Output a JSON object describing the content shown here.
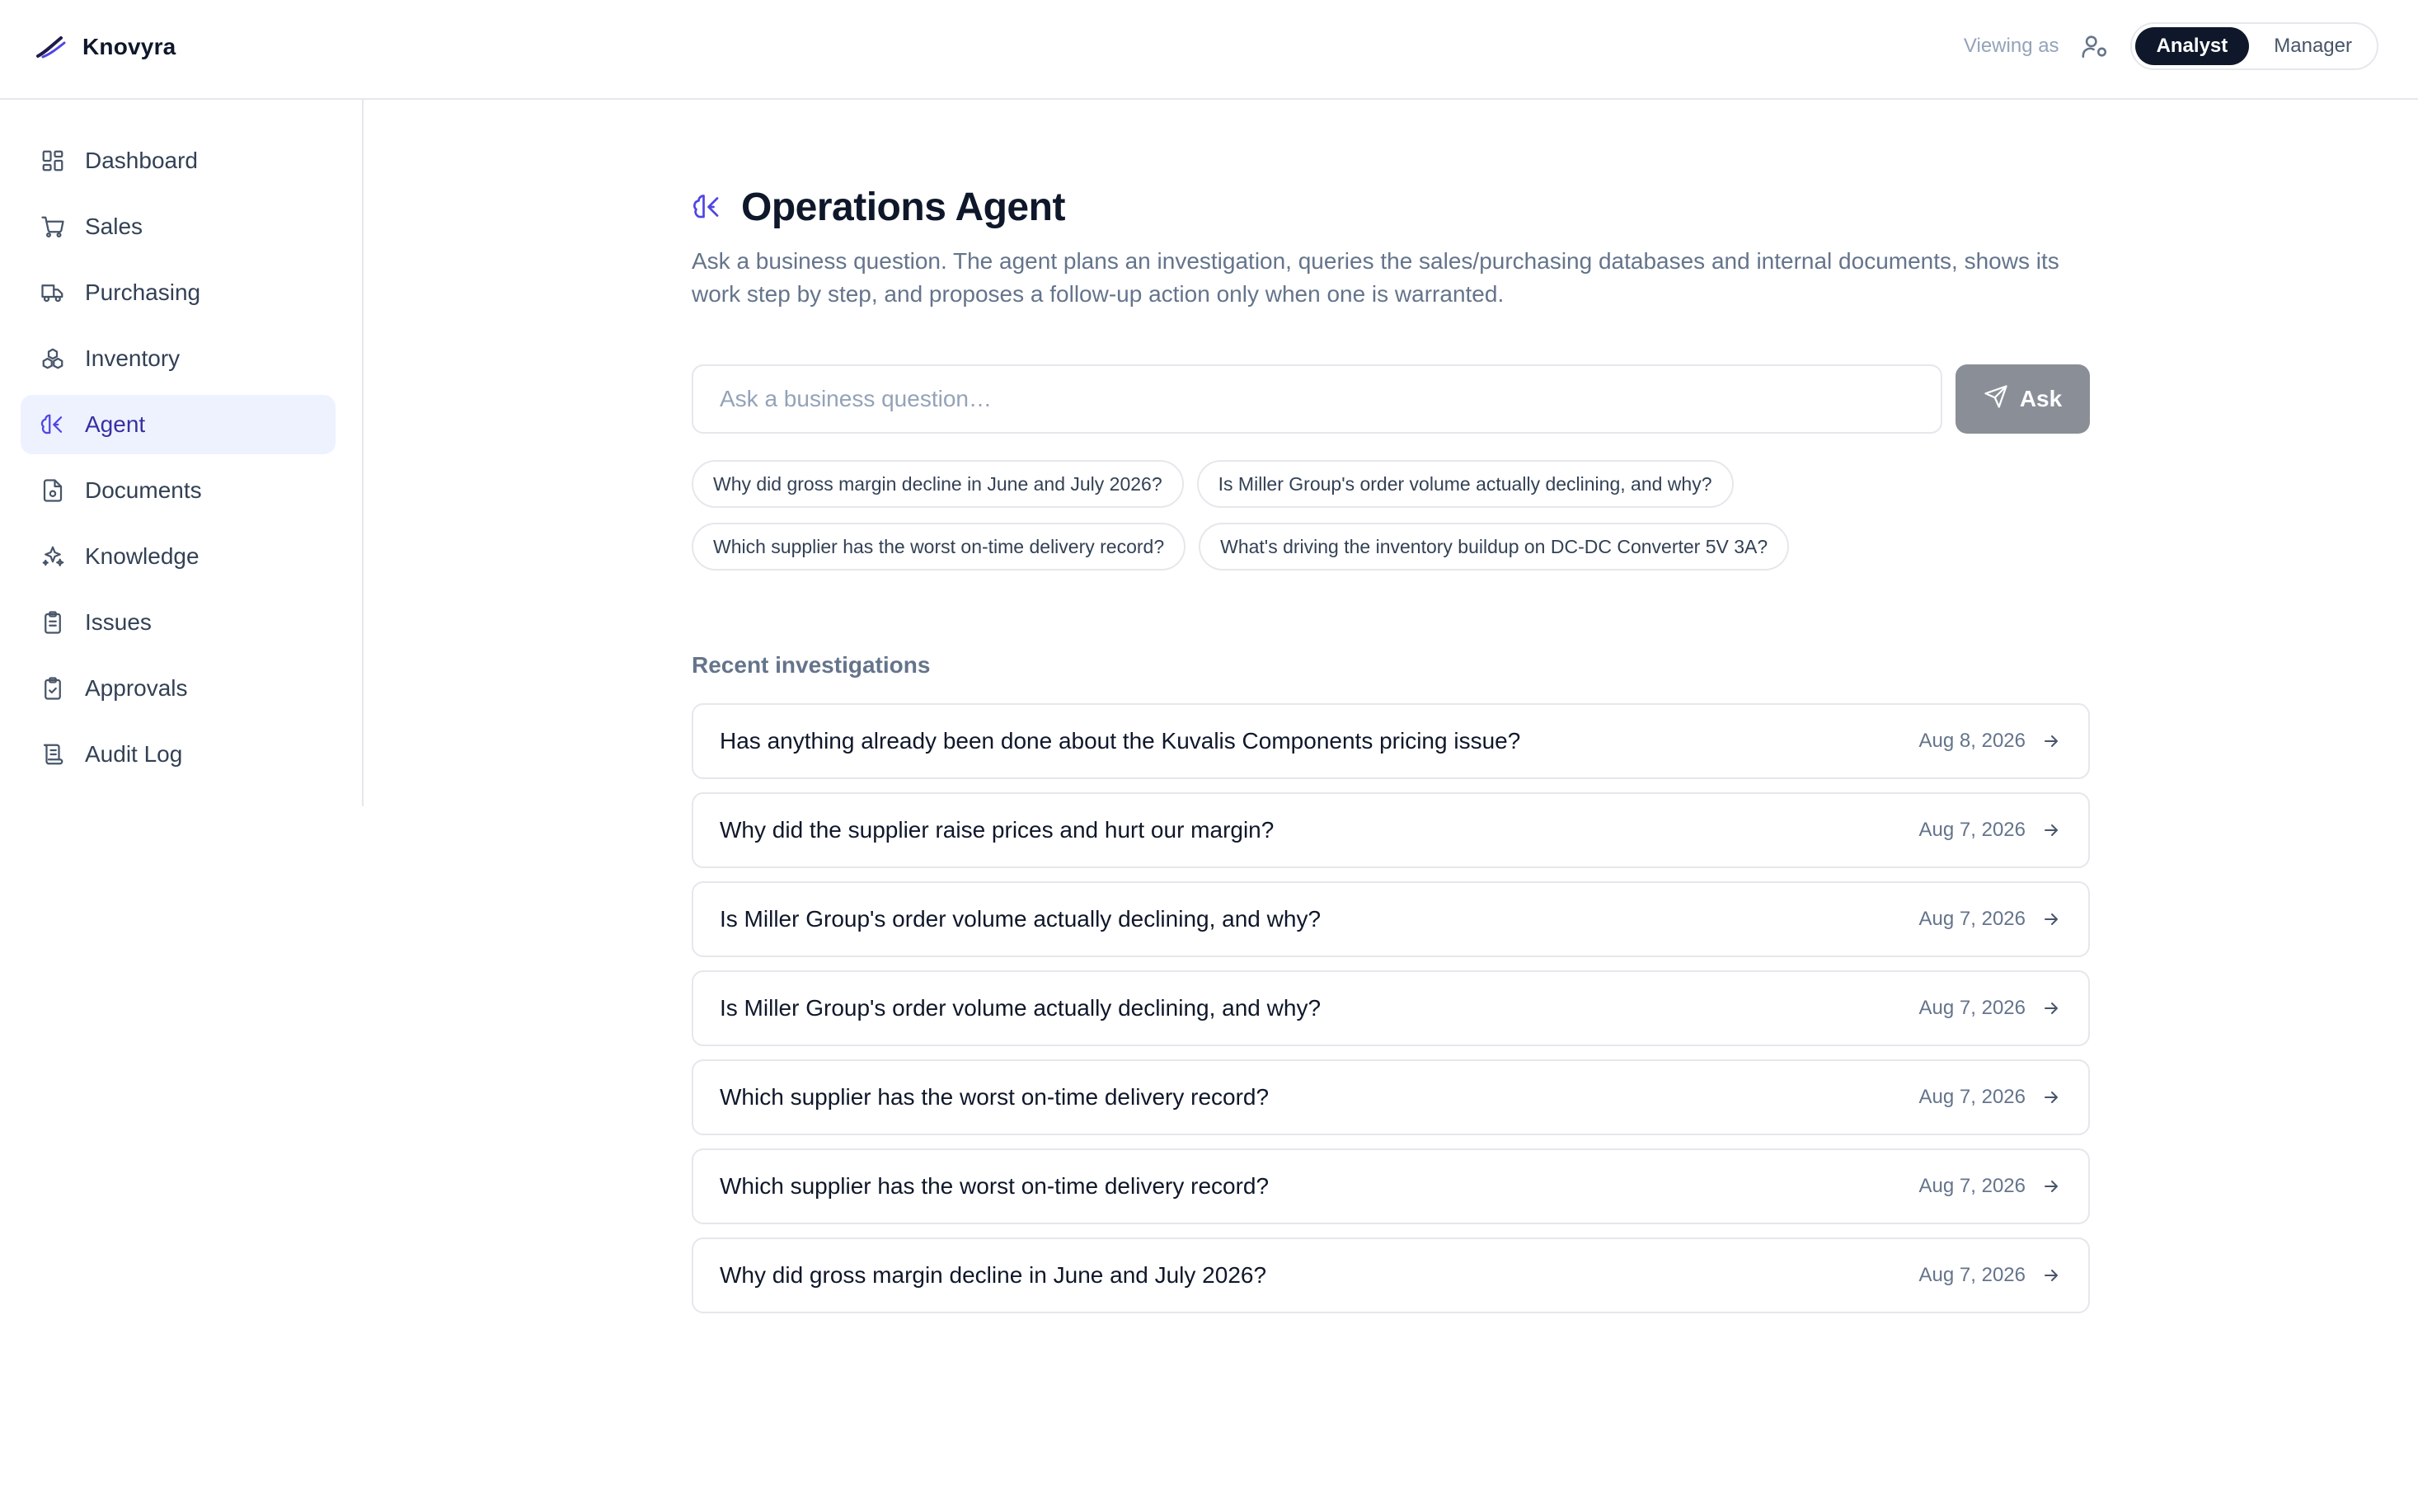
{
  "brand": {
    "name": "Knovyra"
  },
  "header": {
    "viewing_label": "Viewing as",
    "roles": [
      {
        "label": "Analyst",
        "active": true
      },
      {
        "label": "Manager",
        "active": false
      }
    ]
  },
  "sidebar": {
    "items": [
      {
        "label": "Dashboard",
        "icon": "dashboard-icon"
      },
      {
        "label": "Sales",
        "icon": "cart-icon"
      },
      {
        "label": "Purchasing",
        "icon": "truck-icon"
      },
      {
        "label": "Inventory",
        "icon": "boxes-icon"
      },
      {
        "label": "Agent",
        "icon": "brain-icon",
        "active": true
      },
      {
        "label": "Documents",
        "icon": "document-icon"
      },
      {
        "label": "Knowledge",
        "icon": "sparkles-icon"
      },
      {
        "label": "Issues",
        "icon": "clipboard-list-icon"
      },
      {
        "label": "Approvals",
        "icon": "clipboard-check-icon"
      },
      {
        "label": "Audit Log",
        "icon": "scroll-icon"
      }
    ]
  },
  "main": {
    "title": "Operations Agent",
    "description": "Ask a business question. The agent plans an investigation, queries the sales/purchasing databases and internal documents, shows its work step by step, and proposes a follow-up action only when one is warranted.",
    "ask": {
      "placeholder": "Ask a business question…",
      "value": "",
      "button_label": "Ask"
    },
    "suggestions": [
      "Why did gross margin decline in June and July 2026?",
      "Is Miller Group's order volume actually declining, and why?",
      "Which supplier has the worst on-time delivery record?",
      "What's driving the inventory buildup on DC-DC Converter 5V 3A?"
    ],
    "recent_title": "Recent investigations",
    "recent": [
      {
        "question": "Has anything already been done about the Kuvalis Components pricing issue?",
        "date": "Aug 8, 2026"
      },
      {
        "question": "Why did the supplier raise prices and hurt our margin?",
        "date": "Aug 7, 2026"
      },
      {
        "question": "Is Miller Group's order volume actually declining, and why?",
        "date": "Aug 7, 2026"
      },
      {
        "question": "Is Miller Group's order volume actually declining, and why?",
        "date": "Aug 7, 2026"
      },
      {
        "question": "Which supplier has the worst on-time delivery record?",
        "date": "Aug 7, 2026"
      },
      {
        "question": "Which supplier has the worst on-time delivery record?",
        "date": "Aug 7, 2026"
      },
      {
        "question": "Why did gross margin decline in June and July 2026?",
        "date": "Aug 7, 2026"
      }
    ]
  },
  "colors": {
    "accent": "#4f46e5",
    "active_nav_bg": "#eef2ff",
    "active_role_bg": "#0f172a",
    "ask_button_bg": "#8a8f97"
  }
}
